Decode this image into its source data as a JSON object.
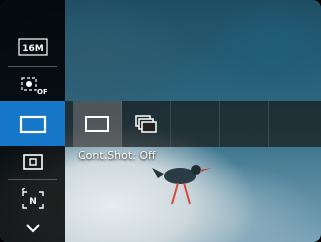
{
  "menu": {
    "items": [
      {
        "id": "resolution",
        "icon": "resolution-16m-icon",
        "text": "16M"
      },
      {
        "id": "face",
        "icon": "face-detect-off-icon",
        "text": "OFF"
      },
      {
        "id": "cont-shot",
        "icon": "single-shot-icon",
        "text": "",
        "selected": true
      },
      {
        "id": "metering",
        "icon": "spot-metering-icon",
        "text": ""
      },
      {
        "id": "af",
        "icon": "af-mode-n-icon",
        "text": "N"
      },
      {
        "id": "more",
        "icon": "chevron-down-icon",
        "text": ""
      }
    ]
  },
  "option_bar": {
    "options": [
      {
        "icon": "single-shot-icon",
        "active": true
      },
      {
        "icon": "continuous-shot-icon",
        "active": false
      },
      {
        "icon": "",
        "active": false
      },
      {
        "icon": "",
        "active": false
      },
      {
        "icon": "",
        "active": false
      }
    ],
    "label": "Cont.Shot: Off"
  },
  "colors": {
    "accent": "#1677c8",
    "panel": "#000000"
  }
}
